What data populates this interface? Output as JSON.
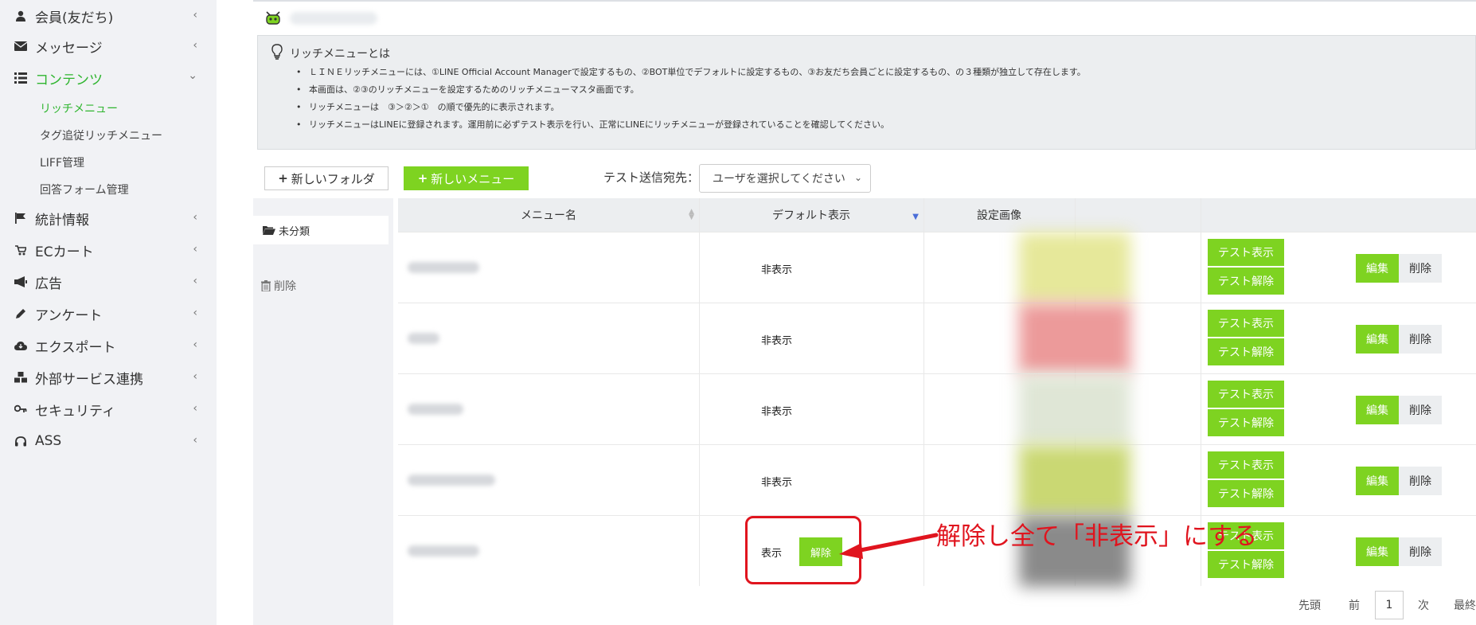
{
  "sidebar": {
    "items": [
      {
        "label": "会員(友だち)",
        "icon": "user-icon"
      },
      {
        "label": "メッセージ",
        "icon": "envelope-icon"
      },
      {
        "label": "コンテンツ",
        "icon": "list-icon",
        "expanded": true
      },
      {
        "label": "統計情報",
        "icon": "flag-icon"
      },
      {
        "label": "ECカート",
        "icon": "cart-icon"
      },
      {
        "label": "広告",
        "icon": "megaphone-icon"
      },
      {
        "label": "アンケート",
        "icon": "pencil-icon"
      },
      {
        "label": "エクスポート",
        "icon": "cloud-download-icon"
      },
      {
        "label": "外部サービス連携",
        "icon": "cubes-icon"
      },
      {
        "label": "セキュリティ",
        "icon": "key-icon"
      },
      {
        "label": "ASS",
        "icon": "headphones-icon"
      }
    ],
    "sub_items": [
      {
        "label": "リッチメニュー",
        "active": true
      },
      {
        "label": "タグ追従リッチメニュー"
      },
      {
        "label": "LIFF管理"
      },
      {
        "label": "回答フォーム管理"
      }
    ]
  },
  "info": {
    "title": "リッチメニューとは",
    "bullets": [
      "ＬＩＮＥリッチメニューには、①LINE Official Account Managerで設定するもの、②BOT単位でデフォルトに設定するもの、③お友だち会員ごとに設定するもの、の３種類が独立して存在します。",
      "本画面は、②③のリッチメニューを設定するためのリッチメニューマスタ画面です。",
      "リッチメニューは　③＞②＞①　の順で優先的に表示されます。",
      "リッチメニューはLINEに登録されます。運用前に必ずテスト表示を行い、正常にLINEにリッチメニューが登録されていることを確認してください。"
    ]
  },
  "toolbar": {
    "new_folder": "新しいフォルダ",
    "new_menu": "新しいメニュー",
    "send_label": "テスト送信宛先：",
    "send_placeholder": "ユーザを選択してください"
  },
  "folders": {
    "uncategorized": "未分類",
    "delete": "削除"
  },
  "table": {
    "headers": [
      "メニュー名",
      "デフォルト表示",
      "設定画像"
    ],
    "rows": [
      {
        "display": "非表示",
        "thumb_color": "#e6e89a"
      },
      {
        "display": "非表示",
        "thumb_color": "#ec9a9a"
      },
      {
        "display": "非表示",
        "thumb_color": "#dfe6d6"
      },
      {
        "display": "非表示",
        "thumb_color": "#cad873"
      },
      {
        "display": "表示",
        "release": "解除",
        "thumb_color": "#8a8a8a"
      }
    ],
    "test_show": "テスト表示",
    "test_release": "テスト解除",
    "edit": "編集",
    "delete": "削除"
  },
  "pager": {
    "first": "先頭",
    "prev": "前",
    "current": "1",
    "next": "次",
    "last": "最終"
  },
  "annotation": {
    "text": "解除し全て「非表示」にする",
    "color": "#e0141e"
  },
  "colors": {
    "accent": "#7ed321",
    "active_text": "#2fb52f"
  }
}
